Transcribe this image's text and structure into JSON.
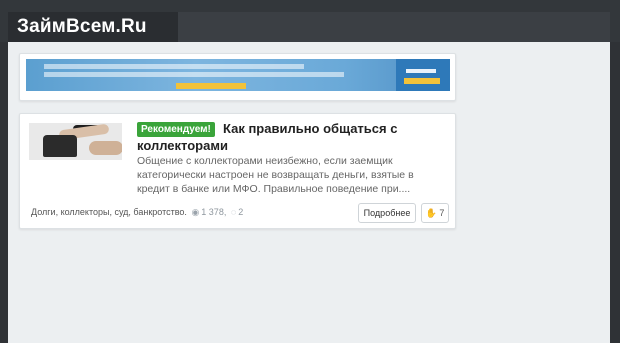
{
  "site": {
    "logo_text": "ЗаймВсем.Ru"
  },
  "article": {
    "badge": "Рекомендуем!",
    "title": "Как правильно общаться с коллекторами",
    "excerpt": "Общение с коллекторами неизбежно, если заемщик категорически настроен не возвращать деньги, взятые в кредит в банке или МФО. Правильное поведение при....",
    "tags": "Долги, коллекторы, суд, банкротство.",
    "views_icon": "eye-icon",
    "views": "1 378,",
    "comments_icon": "comment-icon",
    "comments": "2",
    "more_label": "Подробнее",
    "like_icon": "thumbs-up-icon",
    "likes": "7"
  },
  "colors": {
    "header_bg": "#33373b",
    "logo_bg": "#2a2d31",
    "page_bg": "#eceff1",
    "badge_bg": "#3aa43a"
  }
}
